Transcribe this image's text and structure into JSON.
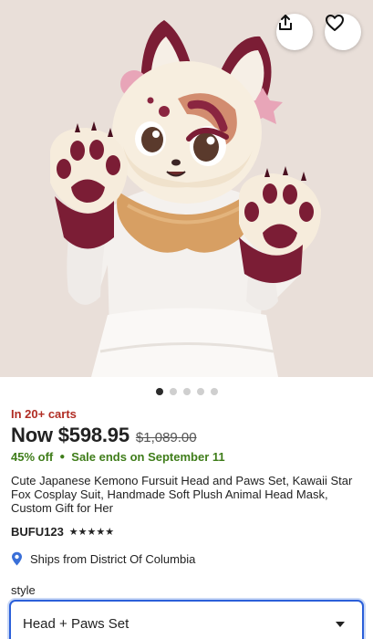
{
  "hero": {
    "share_icon": "share-icon",
    "favorite_icon": "heart-outline-icon",
    "image_count": 5,
    "active_image_index": 0
  },
  "product": {
    "in_carts": "In 20+ carts",
    "price_now": "Now $598.95",
    "price_was": "$1,089.00",
    "discount": "45% off",
    "sale_separator": "●",
    "sale_ends": "Sale ends on September 11",
    "title": "Cute Japanese Kemono Fursuit Head and Paws Set, Kawaii Star Fox Cosplay Suit, Handmade Soft Plush Animal Head Mask, Custom Gift for Her",
    "shop_name": "BUFU123",
    "stars": "★★★★★",
    "rating": 5,
    "ships_from": "Ships from District Of Columbia"
  },
  "options": {
    "style_label": "style",
    "style_selected": "Head + Paws Set"
  },
  "colors": {
    "carts_red": "#b12d24",
    "sale_green": "#3f7d1a",
    "focus_blue": "#2b5fd9",
    "pin_blue": "#3a6fd8"
  }
}
